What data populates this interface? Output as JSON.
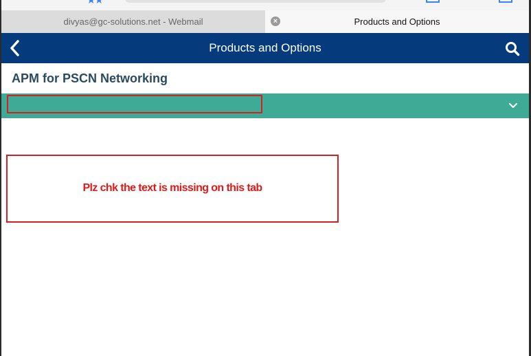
{
  "browser": {
    "tabs": [
      {
        "label": "divyas@gc-solutions.net - Webmail",
        "active": false
      },
      {
        "label": "Products and Options",
        "active": true
      }
    ],
    "tab_close_glyph": "×",
    "accent_color": "#3b82f6"
  },
  "app": {
    "header_title": "Products and Options",
    "header_color": "#053a7d",
    "back_icon": "chevron-left-icon",
    "search_icon": "search-icon"
  },
  "page": {
    "title": "APM for PSCN Networking",
    "accordion": {
      "label": "",
      "color": "#3fab97",
      "icon": "chevron-down-icon"
    }
  },
  "annotation": {
    "comment": "Plz chk the text is missing on this tab",
    "color": "#d42020"
  }
}
